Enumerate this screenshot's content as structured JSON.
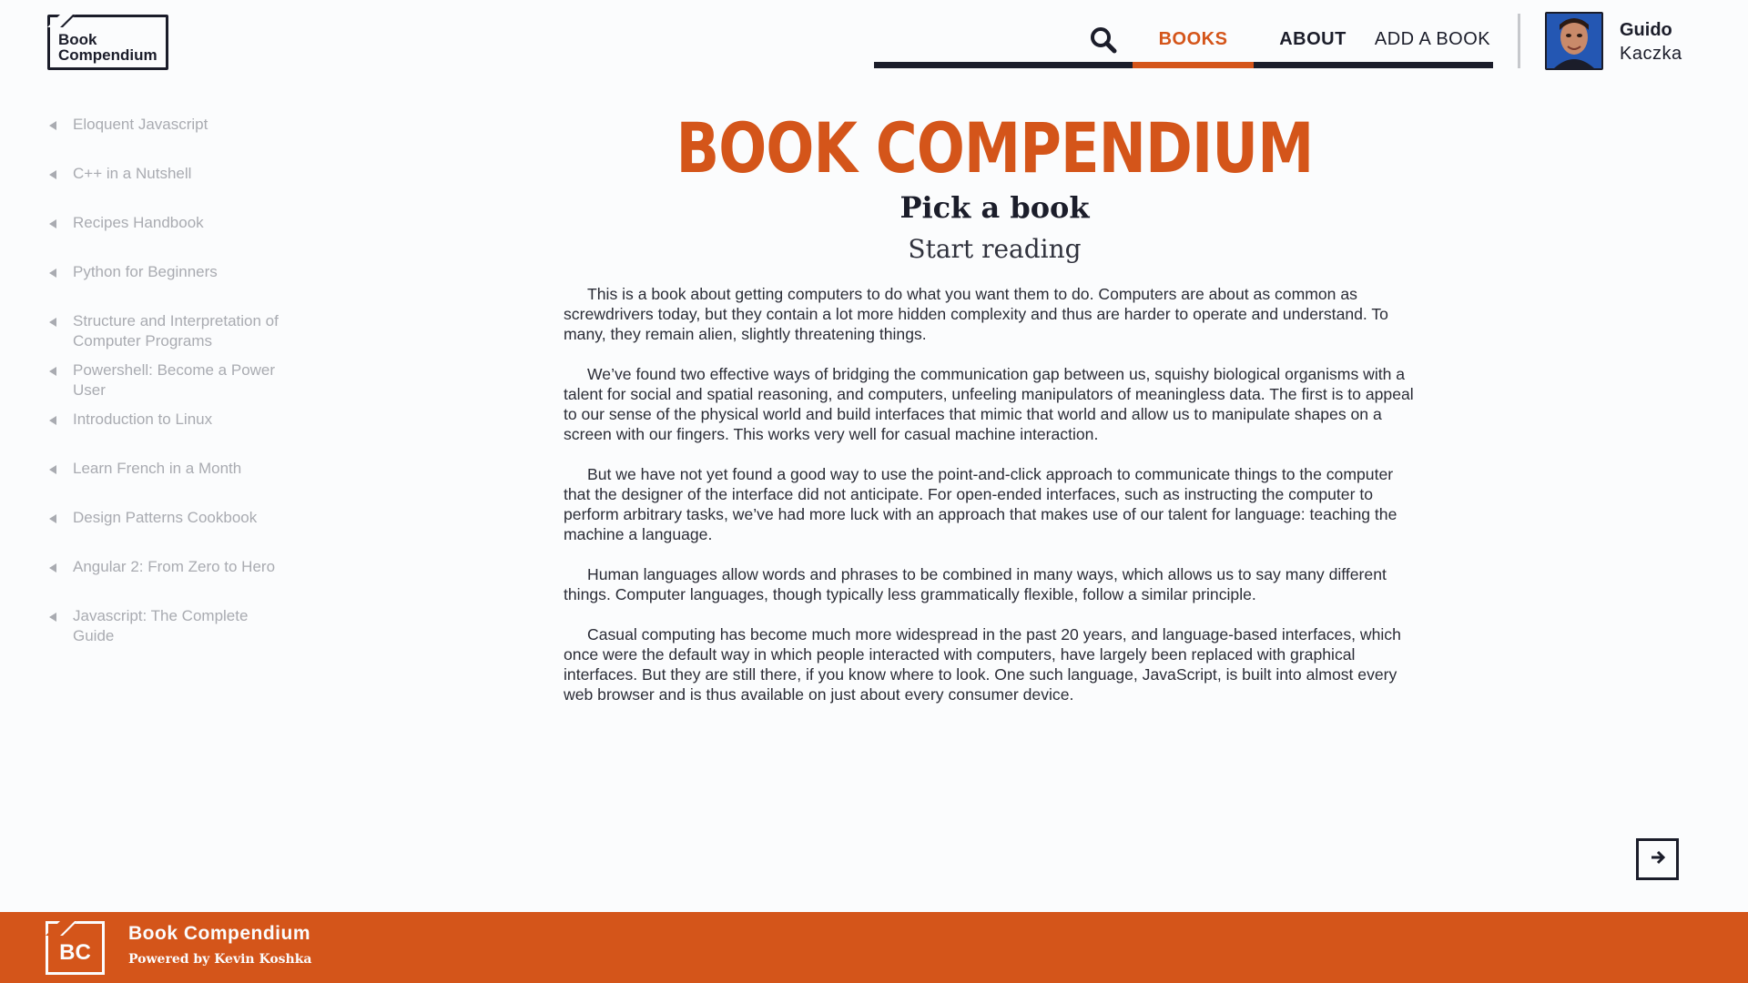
{
  "brand": {
    "logo_line1": "Book",
    "logo_line2": "Compendium",
    "accent_color": "#d4551a",
    "dark_color": "#1b1d2a"
  },
  "nav": {
    "search_icon": "search-icon",
    "items": [
      {
        "label": "BOOKS",
        "active": true
      },
      {
        "label": "ABOUT",
        "active": false
      },
      {
        "label": "ADD A BOOK",
        "active": false
      }
    ]
  },
  "user": {
    "first_name": "Guido",
    "last_name": "Kaczka"
  },
  "sidebar": {
    "items": [
      {
        "label": "Eloquent Javascript"
      },
      {
        "label": "C++ in a Nutshell"
      },
      {
        "label": "Recipes Handbook"
      },
      {
        "label": "Python for Beginners"
      },
      {
        "label": "Structure and Interpretation of Computer Programs"
      },
      {
        "label": "Powershell: Become a Power User"
      },
      {
        "label": "Introduction to Linux"
      },
      {
        "label": "Learn French in a Month"
      },
      {
        "label": "Design Patterns Cookbook"
      },
      {
        "label": "Angular 2: From Zero to Hero"
      },
      {
        "label": "Javascript: The Complete Guide"
      }
    ]
  },
  "main": {
    "title": "BOOK COMPENDIUM",
    "subtitle": "Pick a book",
    "tagline": "Start reading",
    "paragraphs": [
      "This is a book about getting computers to do what you want them to do. Computers are about as common as screwdrivers today, but they contain a lot more hidden complexity and thus are harder to operate and understand. To many, they remain alien, slightly threatening things.",
      "We’ve found two effective ways of bridging the communication gap between us, squishy biological organisms with a talent for social and spatial reasoning, and computers, unfeeling manipulators of meaningless data. The first is to appeal to our sense of the physical world and build interfaces that mimic that world and allow us to manipulate shapes on a screen with our fingers. This works very well for casual machine interaction.",
      "But we have not yet found a good way to use the point-and-click approach to communicate things to the computer that the designer of the interface did not anticipate. For open-ended interfaces, such as instructing the computer to perform arbitrary tasks, we’ve had more luck with an approach that makes use of our talent for language: teaching the machine a language.",
      "Human languages allow words and phrases to be combined in many ways, which allows us to say many different things. Computer languages, though typically less grammatically flexible, follow a similar principle.",
      "Casual computing has become much more widespread in the past 20 years, and language-based interfaces, which once were the default way in which people interacted with computers, have largely been replaced with graphical interfaces. But they are still there, if you know where to look. One such language, JavaScript, is built into almost every web browser and is thus available on just about every consumer device."
    ],
    "next_icon": "arrow-right-icon"
  },
  "footer": {
    "logo_text": "BC",
    "title": "Book Compendium",
    "credit": "Powered by Kevin Koshka"
  }
}
